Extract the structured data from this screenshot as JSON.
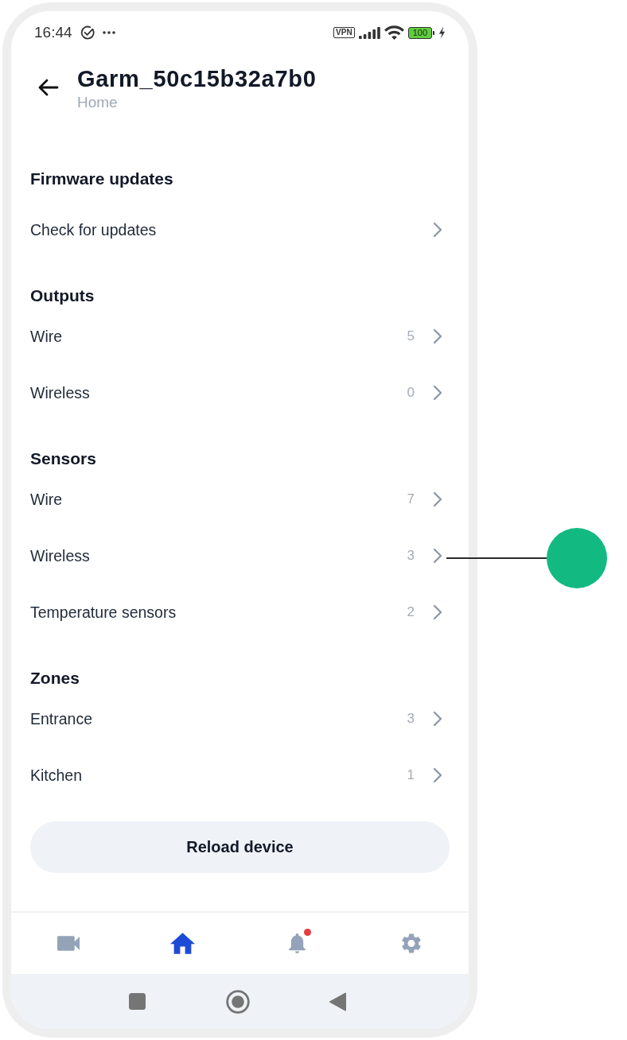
{
  "status_bar": {
    "time": "16:44",
    "vpn": "VPN",
    "battery": "100"
  },
  "header": {
    "title": "Garm_50c15b32a7b0",
    "subtitle": "Home"
  },
  "sections": [
    {
      "title": "Firmware updates",
      "rows": [
        {
          "label": "Check for updates",
          "annotated": false
        }
      ]
    },
    {
      "title": "Outputs",
      "rows": [
        {
          "label": "Wire",
          "count": "5",
          "annotated": false
        },
        {
          "label": "Wireless",
          "count": "0",
          "annotated": false
        }
      ]
    },
    {
      "title": "Sensors",
      "rows": [
        {
          "label": "Wire",
          "count": "7",
          "annotated": false
        },
        {
          "label": "Wireless",
          "count": "3",
          "annotated": true
        },
        {
          "label": "Temperature sensors",
          "count": "2",
          "annotated": false
        }
      ]
    },
    {
      "title": "Zones",
      "rows": [
        {
          "label": "Entrance",
          "count": "3",
          "annotated": false
        },
        {
          "label": "Kitchen",
          "count": "1",
          "annotated": false
        }
      ]
    }
  ],
  "reload_button": {
    "label": "Reload device"
  },
  "bottom_nav": [
    {
      "kind": "video",
      "selected": false,
      "unread": false
    },
    {
      "kind": "home",
      "selected": true,
      "unread": false
    },
    {
      "kind": "alerts",
      "selected": false,
      "unread": true
    },
    {
      "kind": "settings",
      "selected": false,
      "unread": false
    }
  ],
  "system_nav": [
    {
      "kind": "recents"
    },
    {
      "kind": "home"
    },
    {
      "kind": "back"
    }
  ]
}
